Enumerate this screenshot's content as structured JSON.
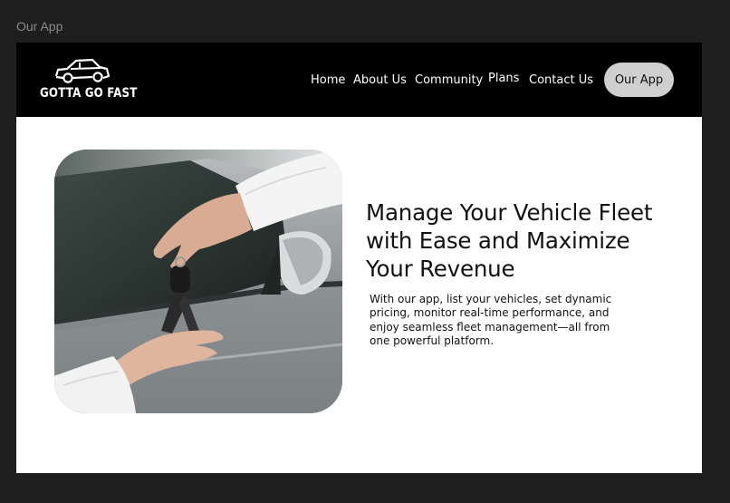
{
  "frame_label": "Our App",
  "brand": {
    "name": "GOTTA GO FAST",
    "logo_icon": "car-icon"
  },
  "nav": {
    "links": [
      "Home",
      "About Us",
      "Community",
      "Plans",
      "Contact Us"
    ],
    "cta": "Our App"
  },
  "hero": {
    "title": "Manage Your Vehicle Fleet with Ease and Maximize Your Revenue",
    "description": "With our app, list your vehicles, set dynamic pricing, monitor real-time performance, and enjoy seamless fleet management—all from one powerful platform.",
    "image_icon": "car-key-handover-photo"
  },
  "colors": {
    "page_bg": "#1e1e1e",
    "navbar_bg": "#000000",
    "cta_bg": "#cfcfcf",
    "content_bg": "#ffffff"
  }
}
